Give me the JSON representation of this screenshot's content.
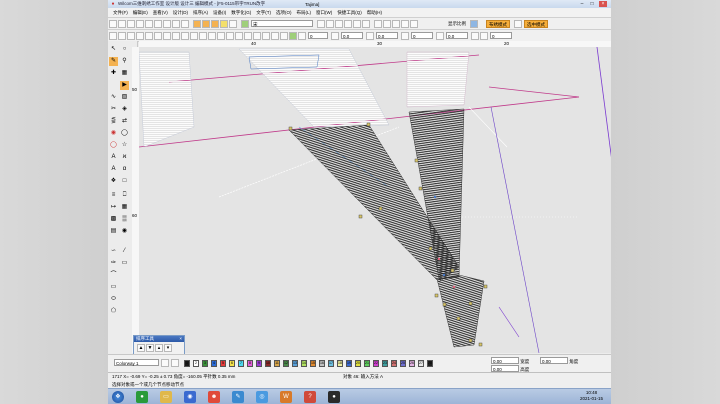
{
  "window": {
    "title": "Wilcom三维刺绣工作室 设计版 设计三 编辑模式 - [F5-0115带字TRUN改字",
    "machine": "Tajima]"
  },
  "menu": [
    "文件(F)",
    "编辑(E)",
    "查看(V)",
    "设计(D)",
    "排序(A)",
    "设备(I)",
    "数字化(G)",
    "文字(T)",
    "选项(O)",
    "布局(L)",
    "窗口(W)",
    "快捷工具(Q)",
    "帮助(H)"
  ],
  "toolbar2": {
    "font_value": "宋",
    "zoom_label": "显示比例",
    "view_badge": "布绣模式",
    "mode_badge": "选中模式"
  },
  "toolbar3": {
    "field_a": "0",
    "field_b": "0.0",
    "field_c": "0.0",
    "field_d": "0",
    "field_e": "0.0",
    "field_f": "0"
  },
  "rulers": {
    "h": [
      "40",
      "30",
      "20"
    ],
    "v": [
      "50",
      "60"
    ]
  },
  "panel": {
    "title": "排序工具"
  },
  "palette": {
    "colorway": "Colorway 1",
    "swatches": [
      {
        "n": "1",
        "c": "#1a1a1a"
      },
      {
        "n": "2",
        "c": "#ffffff"
      },
      {
        "n": "3",
        "c": "#3a8f3a"
      },
      {
        "n": "4",
        "c": "#2b6bd6"
      },
      {
        "n": "5",
        "c": "#e53a3a"
      },
      {
        "n": "6",
        "c": "#f3e04a"
      },
      {
        "n": "7",
        "c": "#4dd9f0"
      },
      {
        "n": "8",
        "c": "#e35fd8"
      },
      {
        "n": "9",
        "c": "#9a3ad0"
      },
      {
        "n": "10",
        "c": "#8b2a2a"
      },
      {
        "n": "11",
        "c": "#d8a64a"
      },
      {
        "n": "12",
        "c": "#4a8a4a"
      },
      {
        "n": "13",
        "c": "#5aa0d8"
      },
      {
        "n": "14",
        "c": "#b0e060"
      },
      {
        "n": "15",
        "c": "#e08a30"
      },
      {
        "n": "16",
        "c": "#c0c0c0"
      },
      {
        "n": "17",
        "c": "#6ec0e0"
      },
      {
        "n": "18",
        "c": "#f0f0a0"
      },
      {
        "n": "19",
        "c": "#3a6ad0"
      },
      {
        "n": "20",
        "c": "#e0e040"
      },
      {
        "n": "21",
        "c": "#60d060"
      },
      {
        "n": "22",
        "c": "#d040d0"
      },
      {
        "n": "23",
        "c": "#40a0a0"
      },
      {
        "n": "24",
        "c": "#d07070"
      },
      {
        "n": "25",
        "c": "#7070d0"
      },
      {
        "n": "26",
        "c": "#e0b0e0"
      },
      {
        "n": "27",
        "c": "#e8e8e8"
      },
      {
        "n": "28",
        "c": "#202020"
      }
    ],
    "right_fields": [
      {
        "label": "宽度",
        "value": "0.00"
      },
      {
        "label": "高度",
        "value": "0.00"
      },
      {
        "label": "角度",
        "value": "0.00"
      }
    ]
  },
  "status": {
    "line1": "1717  X= -0.69 Y= -0.25  ± 0.73 角度= -160.05  平针数 0.35 mm",
    "line2": "选择对象或一个或几个节点移动节点",
    "object": "对象 46: 输入方法 A"
  },
  "clock": {
    "time": "10:48",
    "date": "2021-01-15"
  },
  "colors": {
    "accent": "#f6ae3a",
    "stitch_white": "#ffffff",
    "stitch_dark": "#222222",
    "guide_magenta": "#c03a8a",
    "guide_purple": "#7a3ad0"
  }
}
